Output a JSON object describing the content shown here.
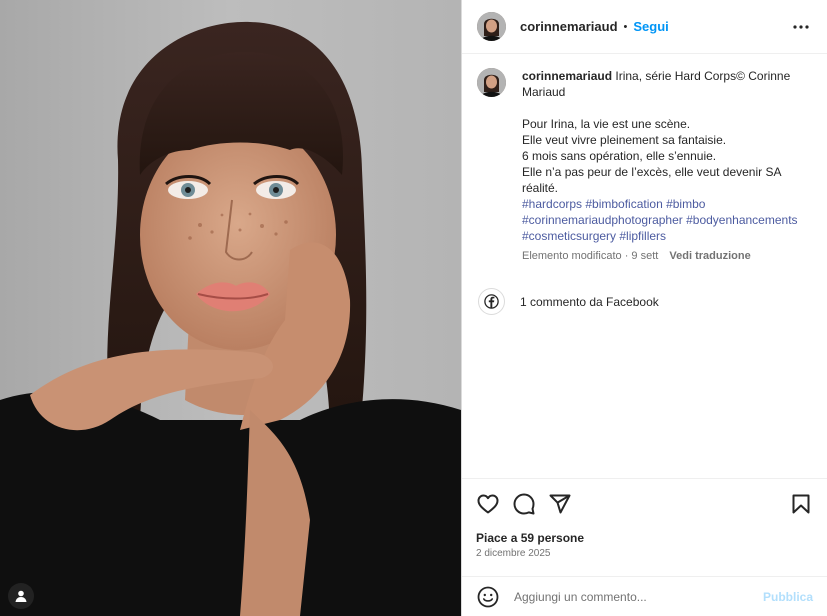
{
  "header": {
    "username": "corinnemariaud",
    "separator": "•",
    "follow_label": "Segui"
  },
  "caption": {
    "username": "corinnemariaud",
    "title": "Irina, série Hard Corps© Corinne Mariaud",
    "lines": [
      "Pour Irina, la vie est une scène.",
      "Elle veut vivre pleinement sa fantaisie.",
      "6 mois sans opération, elle s’ennuie.",
      "Elle n’a pas peur de l’excès, elle veut devenir SA réalité."
    ],
    "hashtags": "#hardcorps #bimbofication #bimbo #corinnemariaudphotographer #bodyenhancements #cosmeticsurgery #lipfillers",
    "edited_label": "Elemento modificato · 9 sett",
    "translate_label": "Vedi traduzione"
  },
  "facebook_comments": {
    "label": "1 commento da Facebook",
    "icon": "facebook-icon"
  },
  "actions": {
    "icons": [
      "heart-icon",
      "comment-icon",
      "share-icon",
      "bookmark-icon"
    ]
  },
  "likes_label": "Piace a 59 persone",
  "date_label": "2 dicembre 2025",
  "comment_box": {
    "placeholder": "Aggiungi un commento...",
    "publish_label": "Pubblica"
  },
  "colors": {
    "link": "#4c5ba0",
    "follow": "#0095f6",
    "publish_disabled": "#b2dffc",
    "muted": "#737373"
  }
}
